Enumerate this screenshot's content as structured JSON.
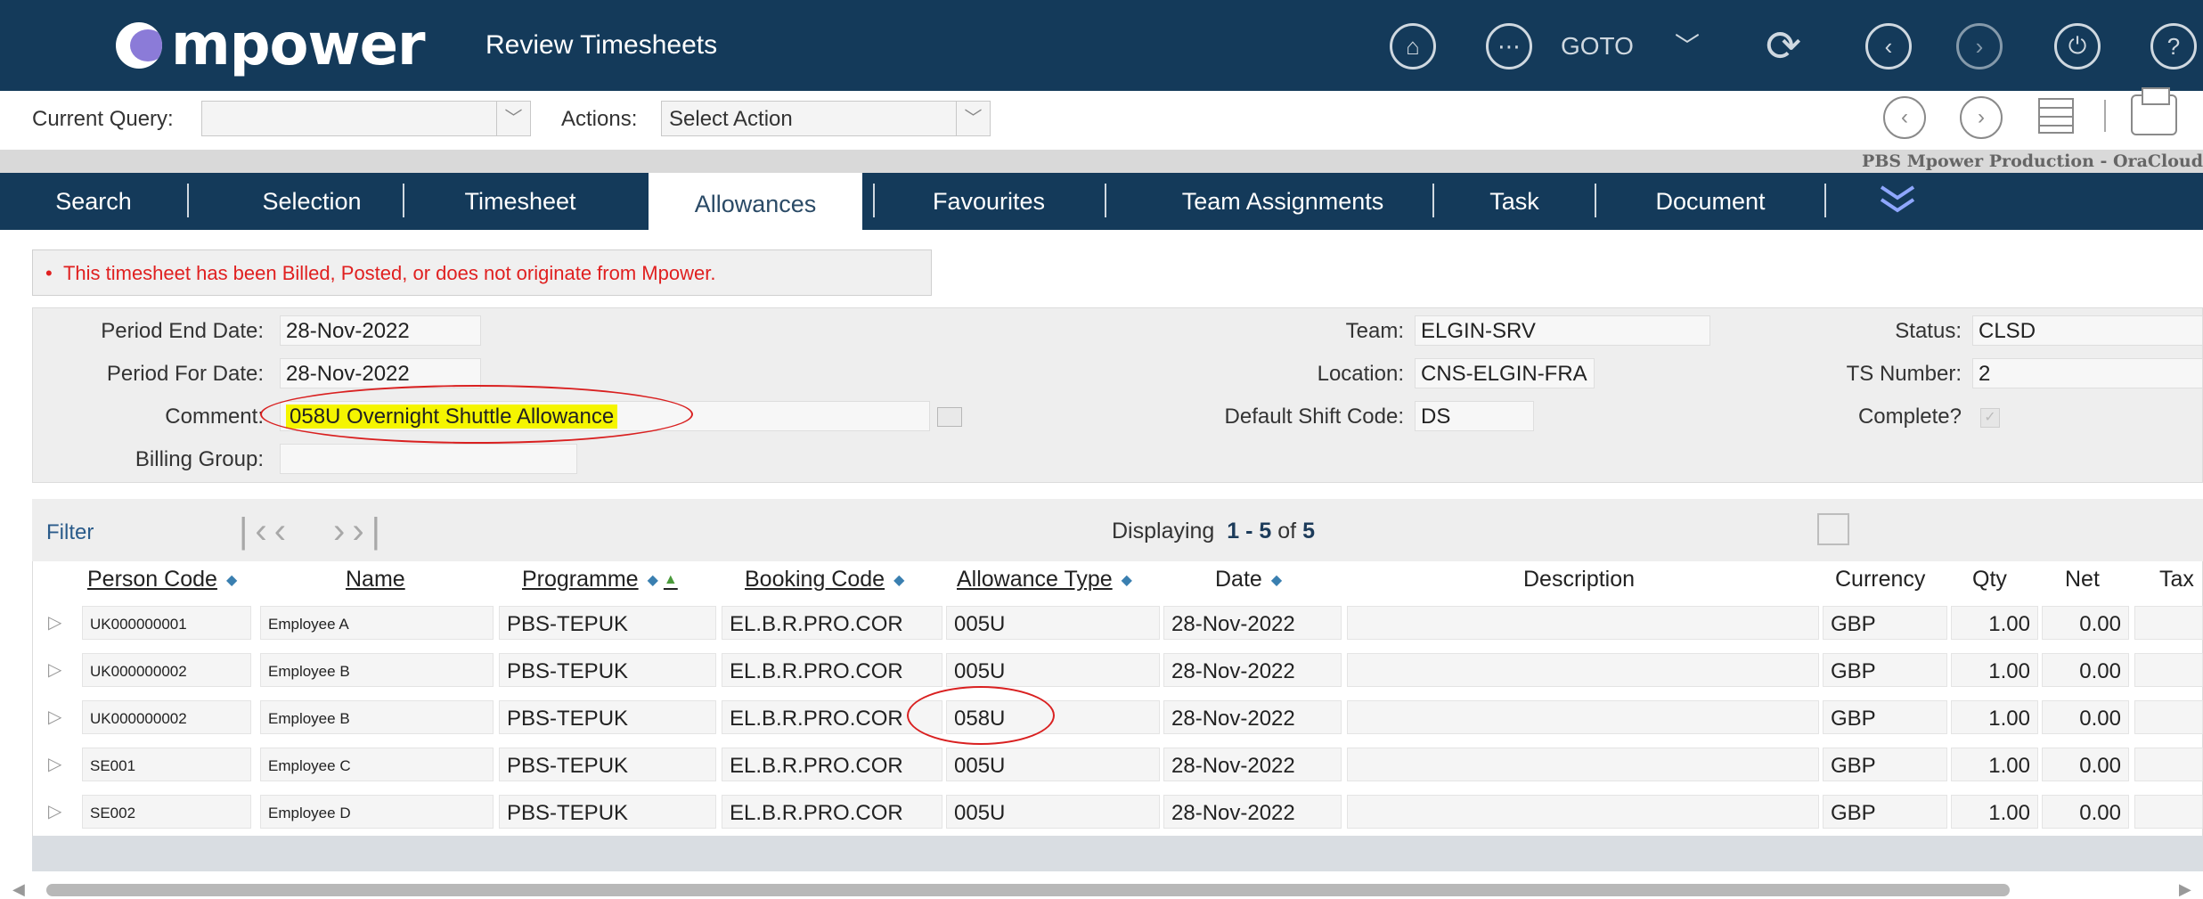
{
  "header": {
    "logo_text": "mpower",
    "page_title": "Review Timesheets",
    "goto_label": "GOTO"
  },
  "query_bar": {
    "current_query_label": "Current Query:",
    "current_query_value": "",
    "actions_label": "Actions:",
    "actions_value": "Select Action"
  },
  "environment": "PBS Mpower Production - OraCloud",
  "tabs": [
    {
      "label": "Search",
      "active": false
    },
    {
      "label": "Selection",
      "active": false
    },
    {
      "label": "Timesheet",
      "active": false
    },
    {
      "label": "Allowances",
      "active": true
    },
    {
      "label": "Favourites",
      "active": false
    },
    {
      "label": "Team Assignments",
      "active": false
    },
    {
      "label": "Task",
      "active": false
    },
    {
      "label": "Document",
      "active": false
    }
  ],
  "message": "This timesheet has been Billed, Posted, or does not originate from Mpower.",
  "form": {
    "period_end_date_label": "Period End Date:",
    "period_end_date": "28-Nov-2022",
    "period_for_date_label": "Period For Date:",
    "period_for_date": "28-Nov-2022",
    "comment_label": "Comment:",
    "comment": "058U Overnight Shuttle Allowance",
    "billing_group_label": "Billing Group:",
    "billing_group": "",
    "team_label": "Team:",
    "team": "ELGIN-SRV",
    "location_label": "Location:",
    "location": "CNS-ELGIN-FRA",
    "default_shift_code_label": "Default Shift Code:",
    "default_shift_code": "DS",
    "status_label": "Status:",
    "status": "CLSD",
    "ts_number_label": "TS Number:",
    "ts_number": "2",
    "complete_label": "Complete?"
  },
  "grid": {
    "filter_label": "Filter",
    "displaying_prefix": "Displaying",
    "range_start": "1",
    "range_dash": "-",
    "range_end": "5",
    "of_label": "of",
    "total": "5",
    "columns": {
      "person_code": "Person Code",
      "name": "Name",
      "programme": "Programme",
      "booking_code": "Booking Code",
      "allowance_type": "Allowance Type",
      "date": "Date",
      "description": "Description",
      "currency": "Currency",
      "qty": "Qty",
      "net": "Net",
      "tax": "Tax"
    },
    "rows": [
      {
        "person_code": "UK000000001",
        "name": "Employee A",
        "programme": "PBS-TEPUK",
        "booking_code": "EL.B.R.PRO.COR",
        "allowance_type": "005U",
        "date": "28-Nov-2022",
        "description": "",
        "currency": "GBP",
        "qty": "1.00",
        "net": "0.00"
      },
      {
        "person_code": "UK000000002",
        "name": "Employee B",
        "programme": "PBS-TEPUK",
        "booking_code": "EL.B.R.PRO.COR",
        "allowance_type": "005U",
        "date": "28-Nov-2022",
        "description": "",
        "currency": "GBP",
        "qty": "1.00",
        "net": "0.00"
      },
      {
        "person_code": "UK000000002",
        "name": "Employee B",
        "programme": "PBS-TEPUK",
        "booking_code": "EL.B.R.PRO.COR",
        "allowance_type": "058U",
        "date": "28-Nov-2022",
        "description": "",
        "currency": "GBP",
        "qty": "1.00",
        "net": "0.00"
      },
      {
        "person_code": "SE001",
        "name": "Employee C",
        "programme": "PBS-TEPUK",
        "booking_code": "EL.B.R.PRO.COR",
        "allowance_type": "005U",
        "date": "28-Nov-2022",
        "description": "",
        "currency": "GBP",
        "qty": "1.00",
        "net": "0.00"
      },
      {
        "person_code": "SE002",
        "name": "Employee D",
        "programme": "PBS-TEPUK",
        "booking_code": "EL.B.R.PRO.COR",
        "allowance_type": "005U",
        "date": "28-Nov-2022",
        "description": "",
        "currency": "GBP",
        "qty": "1.00",
        "net": "0.00"
      }
    ]
  },
  "icons": {
    "clock": "clock-icon",
    "home": "home-icon",
    "goto": "goto-icon",
    "refresh": "refresh-icon",
    "back": "back-icon",
    "forward": "forward-icon",
    "power": "power-icon",
    "help": "help-icon",
    "print": "print-icon",
    "grid": "grid-view-icon",
    "export": "export-icon"
  },
  "colors": {
    "header_bg": "#143a5a",
    "error_text": "#e02020",
    "highlight": "#f5f500",
    "annotation": "#d92020"
  }
}
